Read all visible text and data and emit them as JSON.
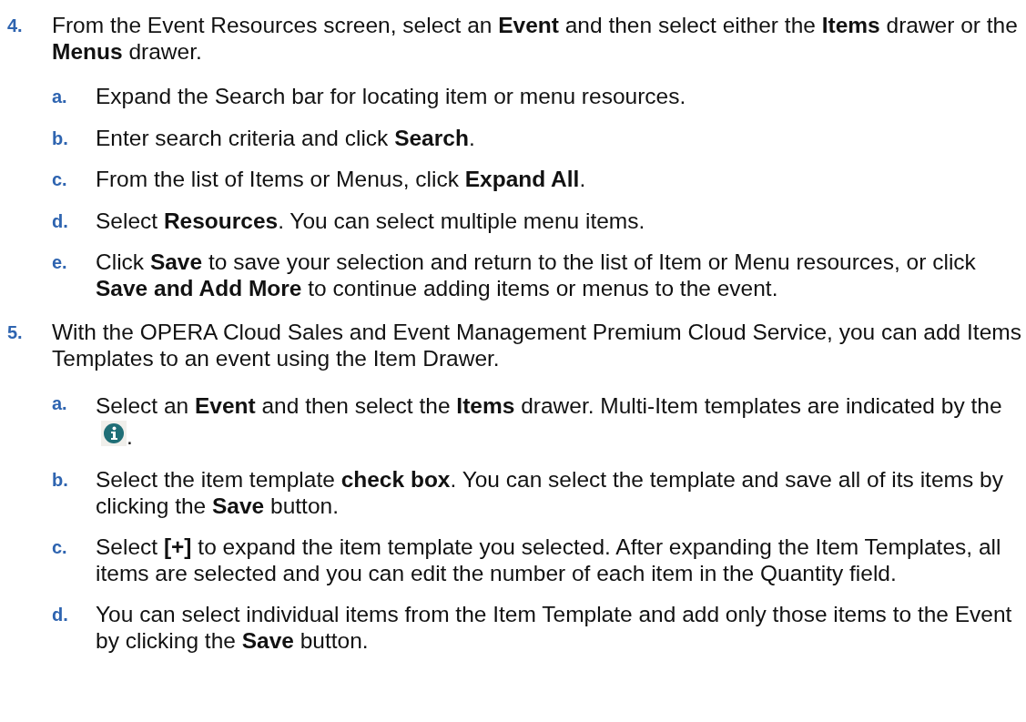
{
  "steps": [
    {
      "number": "4.",
      "text": "From the Event Resources screen, select an **Event** and then select either the **Items** drawer or the **Menus** drawer.",
      "substeps": [
        {
          "letter": "a.",
          "text": "Expand the Search bar for locating item or menu resources."
        },
        {
          "letter": "b.",
          "text": "Enter search criteria and click **Search**."
        },
        {
          "letter": "c.",
          "text": "From the list of Items or Menus, click **Expand All**."
        },
        {
          "letter": "d.",
          "text": "Select **Resources**. You can select multiple menu items."
        },
        {
          "letter": "e.",
          "text": "Click **Save** to save your selection and return to the list of Item or Menu resources, or click **Save and Add More** to continue adding items or menus to the event."
        }
      ]
    },
    {
      "number": "5.",
      "text": "With the OPERA Cloud Sales and Event Management Premium Cloud Service, you can add Items Templates to an event using the Item Drawer.",
      "substeps": [
        {
          "letter": "a.",
          "kind": "with_icon",
          "text": "Select an **Event** and then select the **Items** drawer. Multi-Item templates are indicated by the",
          "text_after": "."
        },
        {
          "letter": "b.",
          "text": "Select the item template **check box**. You can select the template and save all of its items by clicking the **Save** button."
        },
        {
          "letter": "c.",
          "text": "Select **[+]** to expand the item template you selected. After expanding the Item Templates, all items are selected and you can edit the number of each item in the Quantity field."
        },
        {
          "letter": "d.",
          "text": "You can select individual items from the Item Template and add only those items to the Event by clicking the **Save** button."
        }
      ]
    }
  ]
}
